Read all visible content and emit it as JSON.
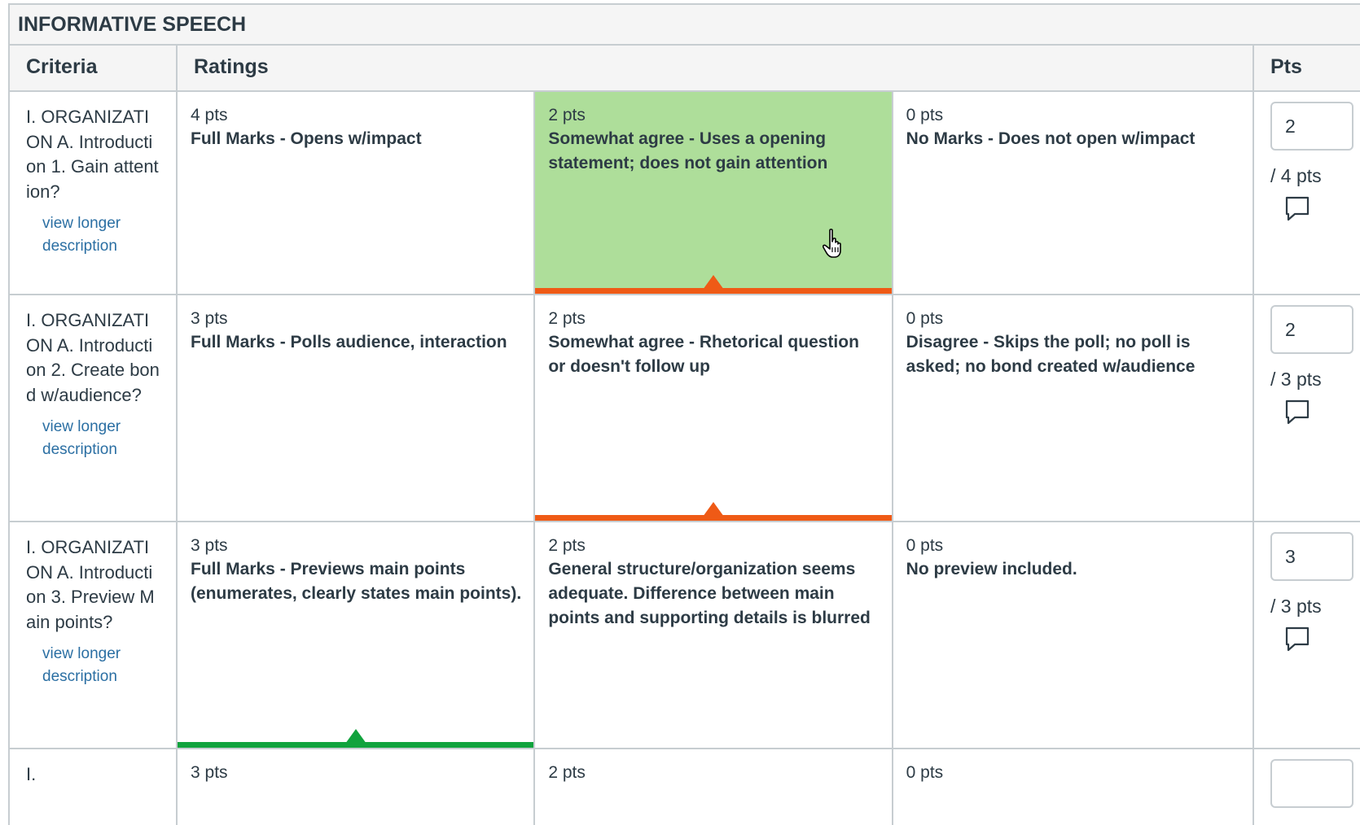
{
  "rubric": {
    "title": "INFORMATIVE SPEECH",
    "headers": {
      "criteria": "Criteria",
      "ratings": "Ratings",
      "pts": "Pts"
    },
    "criteria": [
      {
        "description": "I. ORGANIZATION A. Introduction 1. Gain attention?",
        "link": "view longer description",
        "ratings": [
          {
            "pts": "4 pts",
            "desc": "Full Marks - Opens w/impact"
          },
          {
            "pts": "2 pts",
            "desc": "Somewhat agree - Uses a opening statement; does not gain attention"
          },
          {
            "pts": "0 pts",
            "desc": "No Marks - Does not open w/impact"
          }
        ],
        "score": "2",
        "total": "/ 4 pts"
      },
      {
        "description": "I. ORGANIZATION A. Introduction 2. Create bond w/audience?",
        "link": "view longer description",
        "ratings": [
          {
            "pts": "3 pts",
            "desc": "Full Marks - Polls audience, interaction"
          },
          {
            "pts": "2 pts",
            "desc": "Somewhat agree - Rhetorical question or doesn't follow up"
          },
          {
            "pts": "0 pts",
            "desc": "Disagree - Skips the poll; no poll is asked; no bond created w/audience"
          }
        ],
        "score": "2",
        "total": "/ 3 pts"
      },
      {
        "description": "I. ORGANIZATION A. Introduction 3. Preview Main points?",
        "link": "view longer description",
        "ratings": [
          {
            "pts": "3 pts",
            "desc": "Full Marks - Previews main points (enumerates, clearly states main points)."
          },
          {
            "pts": "2 pts",
            "desc": "General structure/organization seems adequate. Difference between main points and supporting details is blurred"
          },
          {
            "pts": "0 pts",
            "desc": "No preview included."
          }
        ],
        "score": "3",
        "total": "/ 3 pts"
      },
      {
        "description": "I.",
        "ratings": [
          {
            "pts": "3 pts"
          },
          {
            "pts": "2 pts"
          },
          {
            "pts": "0 pts"
          }
        ]
      }
    ]
  },
  "colors": {
    "hover_fill": "#aede9a",
    "selected_marker": "#ef5a16",
    "full_marks_marker": "#11a33d",
    "border": "#c7cdd1"
  },
  "icons": {
    "comment": "comment-icon",
    "cursor": "hand-pointer-icon"
  }
}
